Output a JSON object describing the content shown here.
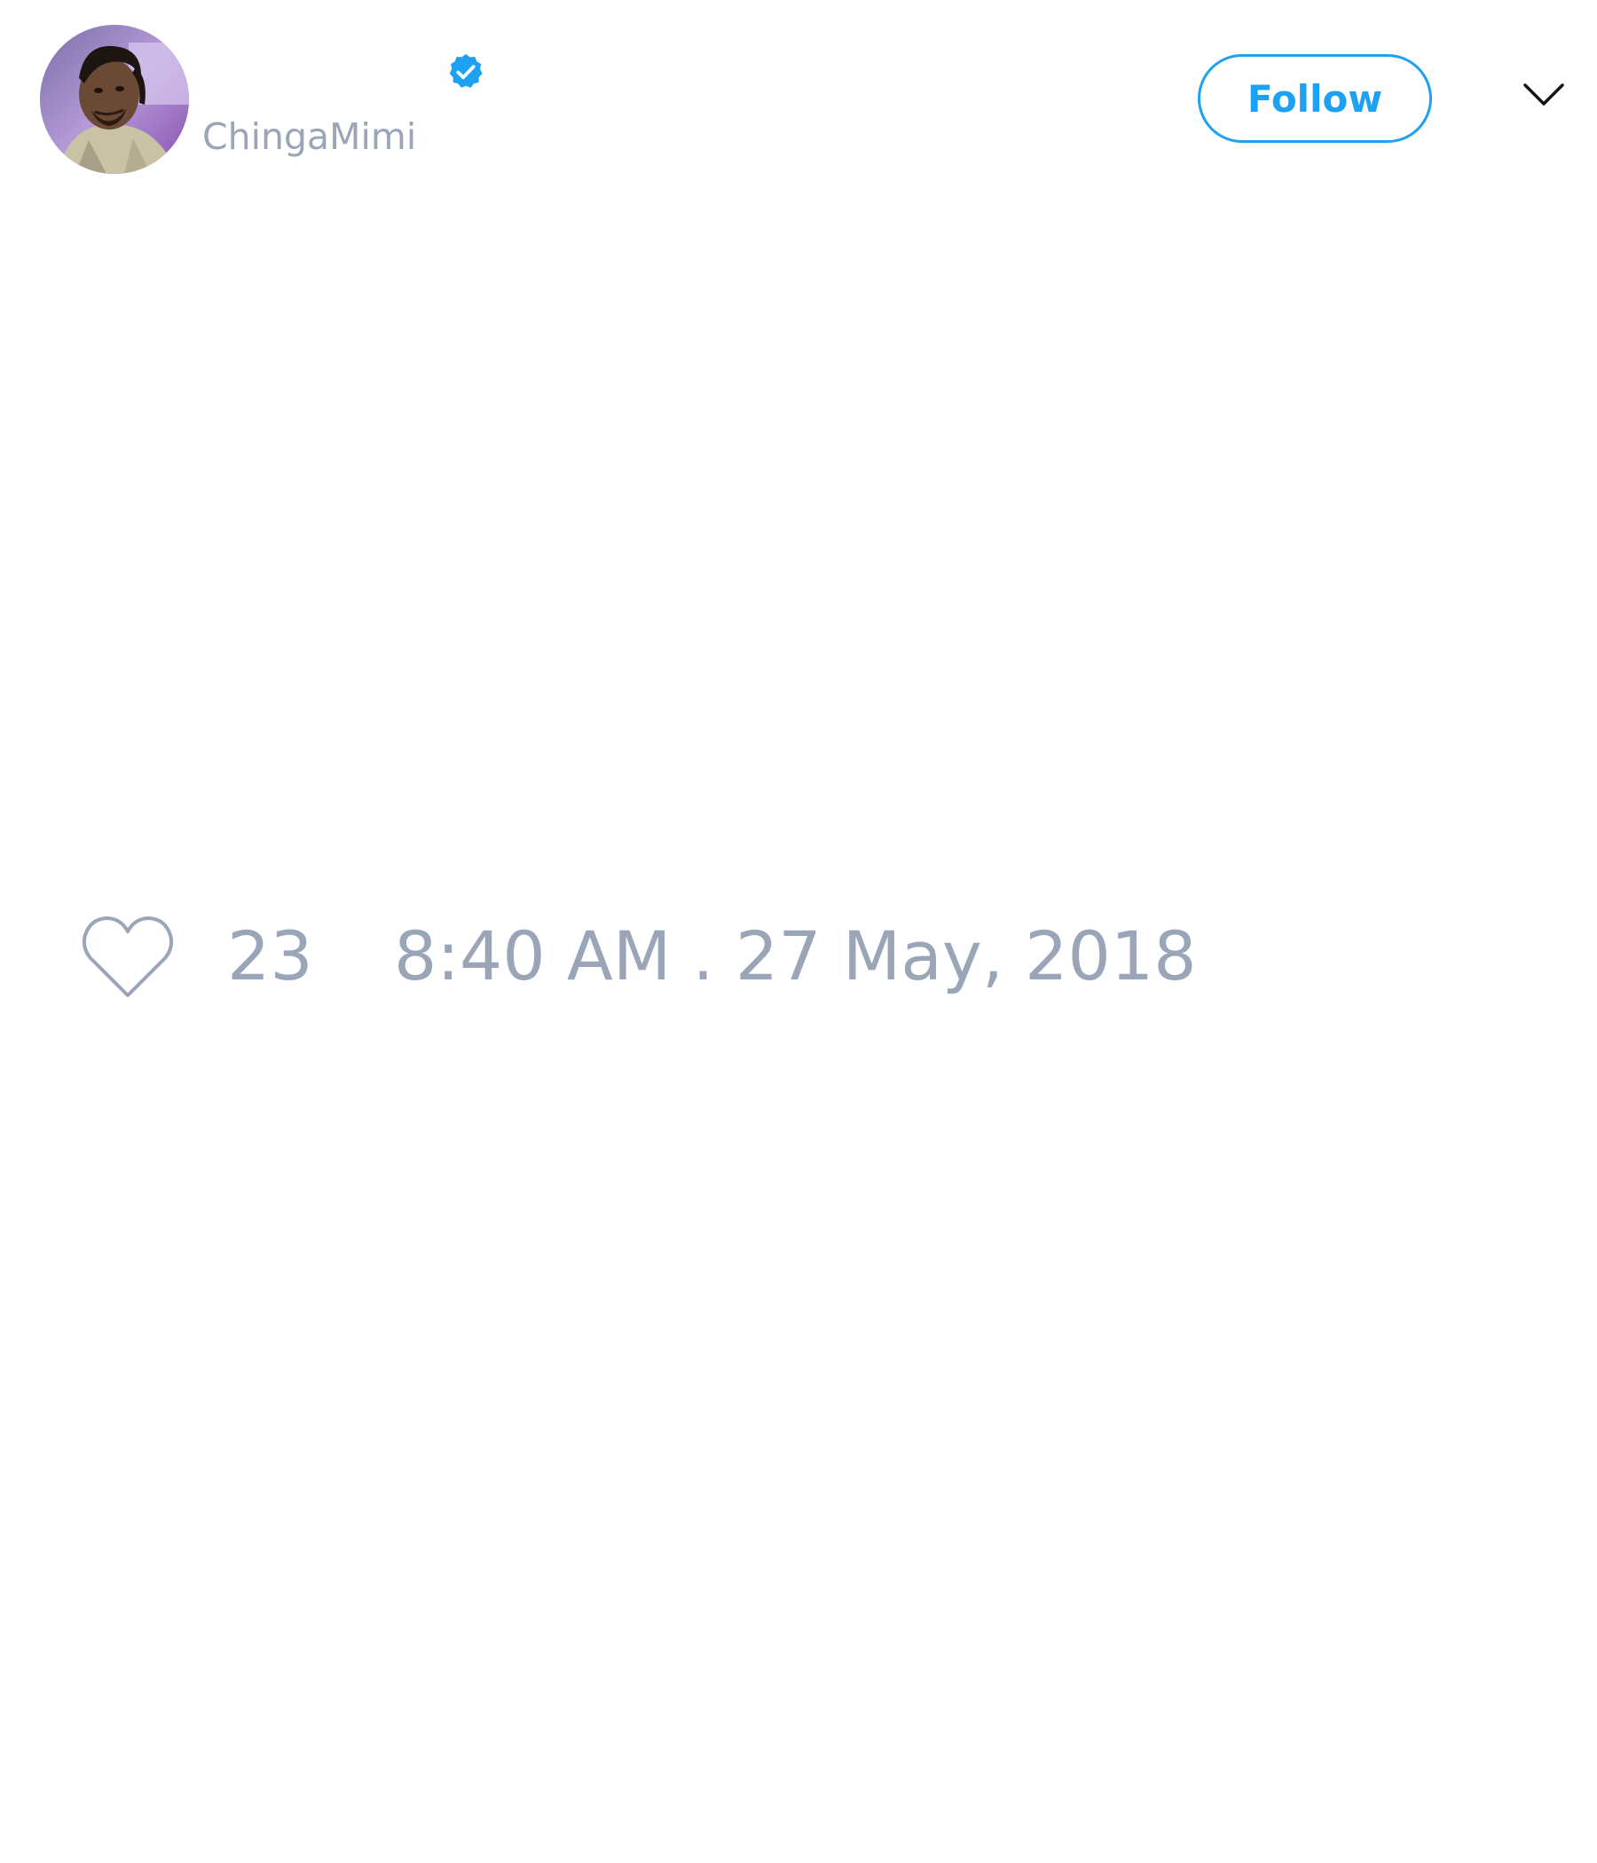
{
  "author": {
    "username": "ChingaMimi",
    "avatar": "profile-photo",
    "verified": true,
    "verified_icon": "verified-badge-icon"
  },
  "header": {
    "follow_label": "Follow",
    "menu_icon": "chevron-down-icon"
  },
  "footer": {
    "like_icon": "heart-icon",
    "like_count": "23",
    "timestamp": "8:40 AM . 27 May, 2018"
  },
  "colors": {
    "accent": "#1da1f2",
    "muted_text": "#9aa6b7",
    "background": "#ffffff"
  }
}
